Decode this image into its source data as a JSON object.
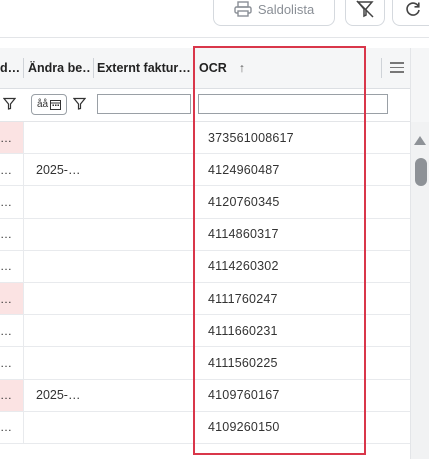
{
  "toolbar": {
    "saldolista_label": "Saldolista"
  },
  "columns": {
    "col0_header": "d…",
    "col1_header": "Ändra be…",
    "col2_header": "Externt faktur…",
    "col3_header": "OCR",
    "sort_indicator": "↑"
  },
  "filter": {
    "aa_text": "åå"
  },
  "rows": [
    {
      "col0": "…",
      "col1": "",
      "ocr": "373561008617",
      "pink": true
    },
    {
      "col0": "…",
      "col1": "2025-…",
      "ocr": "4124960487",
      "pink": false
    },
    {
      "col0": "…",
      "col1": "",
      "ocr": "4120760345",
      "pink": false
    },
    {
      "col0": "…",
      "col1": "",
      "ocr": "4114860317",
      "pink": false
    },
    {
      "col0": "…",
      "col1": "",
      "ocr": "4114260302",
      "pink": false
    },
    {
      "col0": "…",
      "col1": "",
      "ocr": "4111760247",
      "pink": true
    },
    {
      "col0": "…",
      "col1": "",
      "ocr": "4111660231",
      "pink": false
    },
    {
      "col0": "…",
      "col1": "",
      "ocr": "4111560225",
      "pink": false
    },
    {
      "col0": "…",
      "col1": "2025-…",
      "ocr": "4109760167",
      "pink": true
    },
    {
      "col0": "…",
      "col1": "",
      "ocr": "4109260150",
      "pink": false
    }
  ],
  "colors": {
    "highlight": "#d9364a",
    "pink_cell": "#fbe3e3",
    "header_bg": "#f5f6f7"
  }
}
